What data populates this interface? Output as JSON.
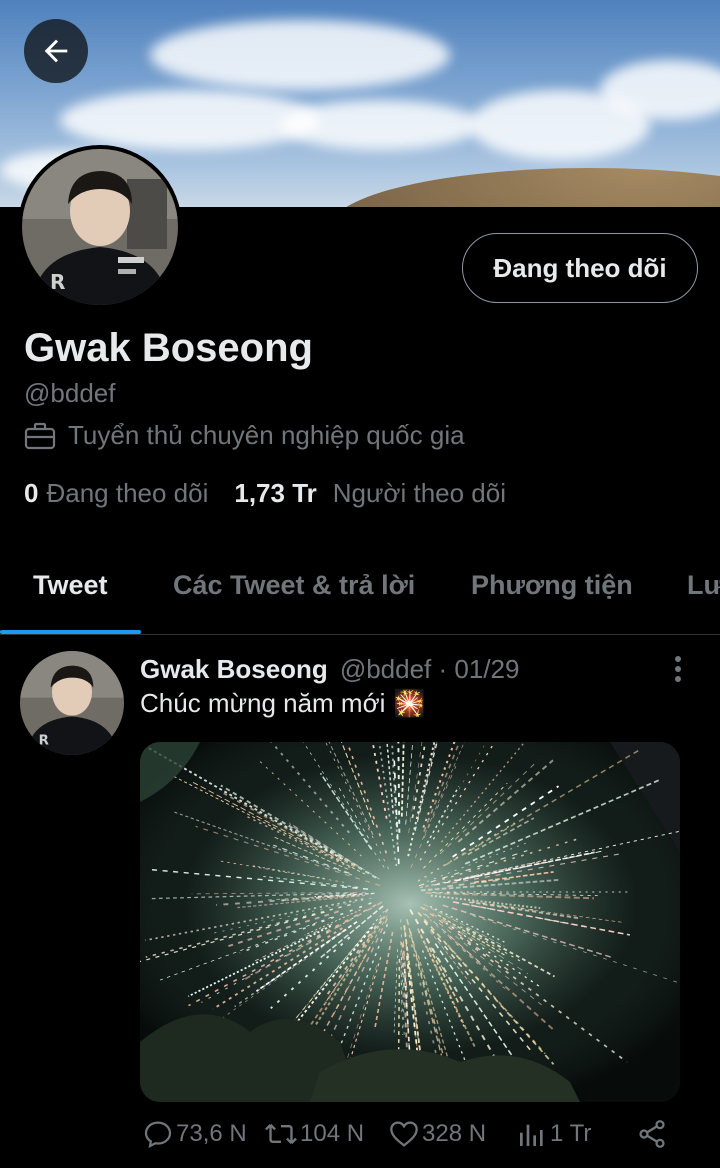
{
  "header": {
    "back_label": "",
    "follow_button": "Đang theo dõi"
  },
  "profile": {
    "name": "Gwak Boseong",
    "handle": "@bddef",
    "bio": "Tuyển thủ chuyên nghiệp quốc gia",
    "following_count": "0",
    "following_label": "Đang theo dõi",
    "followers_count": "1,73 Tr",
    "followers_label": "Người theo dõi"
  },
  "tabs": [
    {
      "label": "Tweet",
      "active": true
    },
    {
      "label": "Các Tweet & trả lời",
      "active": false
    },
    {
      "label": "Phương tiện",
      "active": false
    },
    {
      "label": "Lư",
      "active": false
    }
  ],
  "tweet": {
    "author": "Gwak Boseong",
    "handle": "@bddef",
    "date_sep": " · ",
    "date": "01/29",
    "text": "Chúc mừng năm mới",
    "emoji": "🎇",
    "replies": "73,6 N",
    "retweets": "104 N",
    "likes": "328 N",
    "views": "1 Tr"
  },
  "icons": {
    "back": "arrow-left-icon",
    "bio": "briefcase-icon",
    "more": "more-vertical-icon",
    "reply": "reply-icon",
    "retweet": "retweet-icon",
    "like": "heart-icon",
    "views": "views-icon",
    "share": "share-icon"
  },
  "colors": {
    "accent": "#1d9bf0",
    "text_primary": "#e7e9ea",
    "text_secondary": "#71767b",
    "background": "#000000"
  }
}
